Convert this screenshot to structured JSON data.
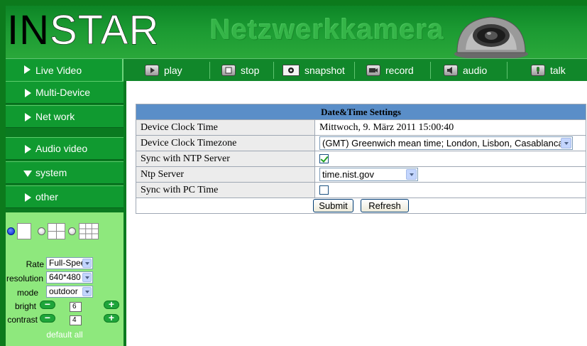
{
  "header": {
    "logo_prefix": "IN",
    "logo_suffix": "STAR",
    "banner_text": "Netzwerkkamera"
  },
  "toolbar": {
    "live_video_label": "Live Video",
    "buttons": [
      {
        "label": "play",
        "icon": "play-icon"
      },
      {
        "label": "stop",
        "icon": "stop-icon"
      },
      {
        "label": "snapshot",
        "icon": "camera-icon"
      },
      {
        "label": "record",
        "icon": "video-camera-icon"
      },
      {
        "label": "audio",
        "icon": "speaker-icon"
      },
      {
        "label": "talk",
        "icon": "microphone-icon"
      }
    ]
  },
  "sidebar": {
    "items": [
      {
        "label": "Multi-Device",
        "expanded": false
      },
      {
        "label": "Net work",
        "expanded": false
      },
      {
        "label": "Audio video",
        "expanded": false
      },
      {
        "label": "system",
        "expanded": true
      },
      {
        "label": "other",
        "expanded": false
      }
    ]
  },
  "controls": {
    "rate_label": "Rate",
    "rate_value": "Full-Speed",
    "resolution_label": "resolution",
    "resolution_value": "640*480",
    "mode_label": "mode",
    "mode_value": "outdoor",
    "bright_label": "bright",
    "bright_value": "6",
    "contrast_label": "contrast",
    "contrast_value": "4",
    "default_all": "default all"
  },
  "settings": {
    "title": "Date&Time Settings",
    "rows": [
      {
        "label": "Device Clock Time",
        "value": "Mittwoch, 9. März 2011 15:00:40"
      },
      {
        "label": "Device Clock Timezone",
        "value": "(GMT) Greenwich mean time; London, Lisbon, Casablanca"
      },
      {
        "label": "Sync with NTP Server",
        "checked": true
      },
      {
        "label": "Ntp Server",
        "value": "time.nist.gov"
      },
      {
        "label": "Sync with PC Time",
        "checked": false
      }
    ],
    "submit_label": "Submit",
    "refresh_label": "Refresh"
  },
  "colors": {
    "brand_green": "#109a30",
    "panel_green": "#8ee87d",
    "table_header_blue": "#5a8ec8"
  }
}
